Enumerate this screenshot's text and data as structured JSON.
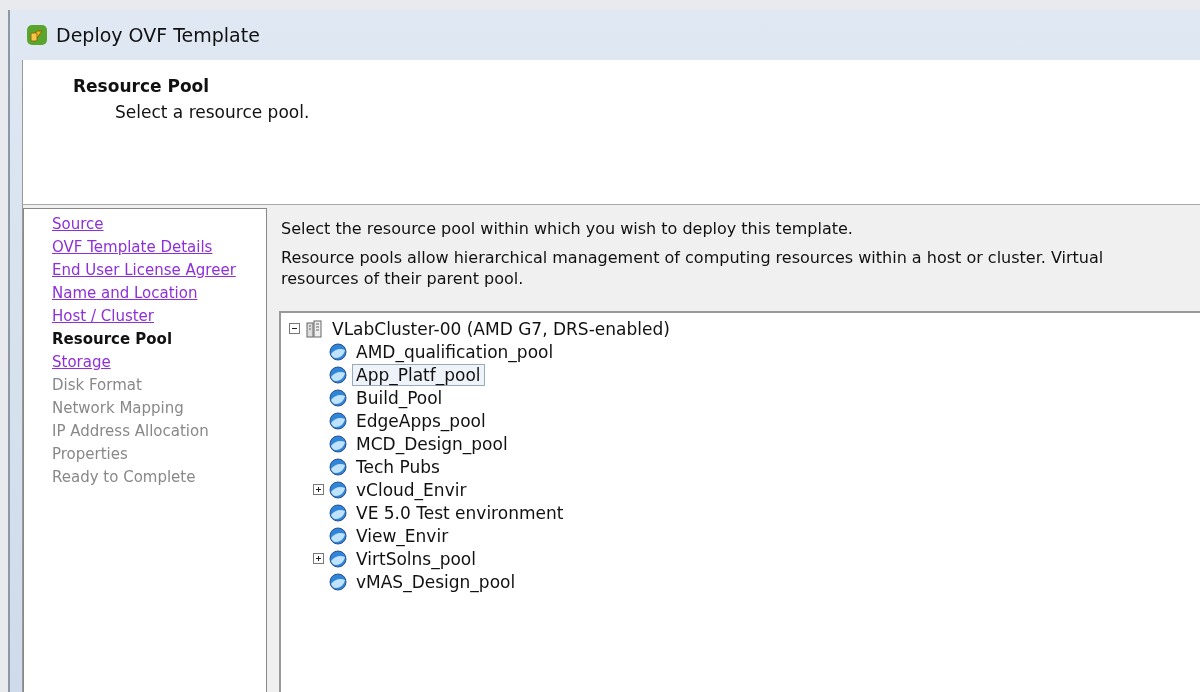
{
  "window": {
    "title": "Deploy OVF Template"
  },
  "header": {
    "title": "Resource Pool",
    "subtitle": "Select a resource pool."
  },
  "steps": [
    {
      "label": "Source",
      "kind": "link",
      "selected": false
    },
    {
      "label": "OVF Template Details",
      "kind": "link",
      "selected": false
    },
    {
      "label": "End User License Agreer",
      "kind": "link",
      "selected": false
    },
    {
      "label": "Name and Location",
      "kind": "link",
      "selected": false
    },
    {
      "label": "Host / Cluster",
      "kind": "link",
      "selected": false
    },
    {
      "label": "Resource Pool",
      "kind": "current",
      "selected": true
    },
    {
      "label": "Storage",
      "kind": "link",
      "selected": false
    },
    {
      "label": "Disk Format",
      "kind": "disabled",
      "selected": false
    },
    {
      "label": "Network Mapping",
      "kind": "disabled",
      "selected": false
    },
    {
      "label": "IP Address Allocation",
      "kind": "disabled",
      "selected": false
    },
    {
      "label": "Properties",
      "kind": "disabled",
      "selected": false
    },
    {
      "label": "Ready to Complete",
      "kind": "disabled",
      "selected": false
    }
  ],
  "content": {
    "instruction": "Select the resource pool within which you wish to deploy this template.",
    "description": "Resource pools allow hierarchical management of computing resources within a host or cluster. Virtual",
    "description_line_2": "resources of their parent pool.",
    "tree": [
      {
        "label": "VLabCluster-00 (AMD G7, DRS-enabled)",
        "kind": "cluster",
        "expanded": true,
        "selected": false,
        "children": [
          {
            "label": "AMD_qualification_pool",
            "kind": "pool",
            "selected": false
          },
          {
            "label": "App_Platf_pool",
            "kind": "pool",
            "selected": true
          },
          {
            "label": "Build_Pool",
            "kind": "pool",
            "selected": false
          },
          {
            "label": "EdgeApps_pool",
            "kind": "pool",
            "selected": false
          },
          {
            "label": "MCD_Design_pool",
            "kind": "pool",
            "selected": false
          },
          {
            "label": "Tech Pubs",
            "kind": "pool",
            "selected": false
          },
          {
            "label": "vCloud_Envir",
            "kind": "pool",
            "expanded": false,
            "selected": false
          },
          {
            "label": "VE 5.0 Test environment",
            "kind": "pool",
            "selected": false
          },
          {
            "label": "View_Envir",
            "kind": "pool",
            "selected": false
          },
          {
            "label": "VirtSolns_pool",
            "kind": "pool",
            "expanded": false,
            "selected": false
          },
          {
            "label": "vMAS_Design_pool",
            "kind": "pool",
            "selected": false
          }
        ]
      }
    ]
  }
}
